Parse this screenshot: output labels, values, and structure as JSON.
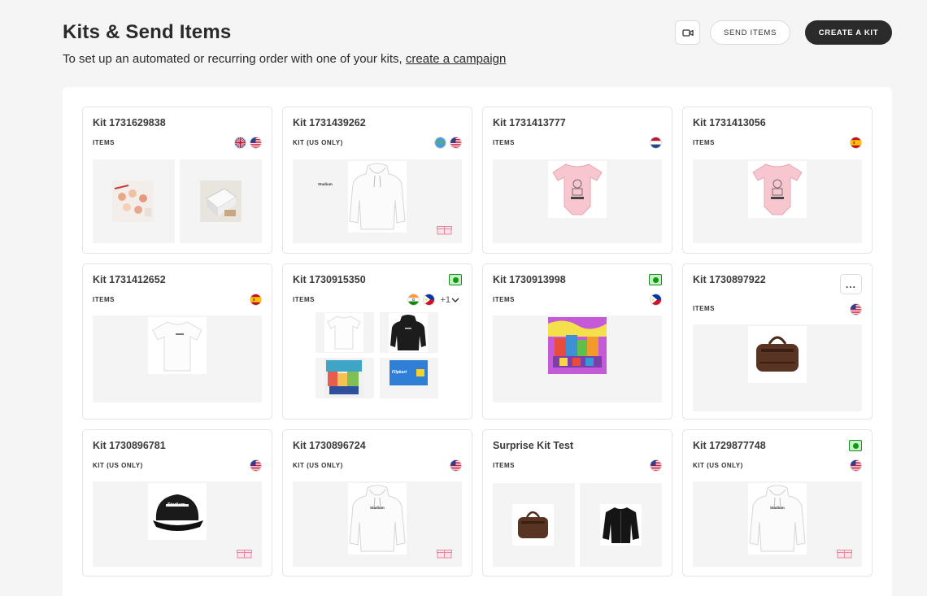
{
  "header": {
    "title": "Kits & Send Items",
    "subtitle_prefix": "To set up an automated or recurring order with one of your kits, ",
    "subtitle_link": "create a campaign",
    "send_items_label": "SEND ITEMS",
    "create_kit_label": "CREATE A KIT"
  },
  "kits": [
    {
      "title": "Kit 1731629838",
      "sub": "ITEMS",
      "flags": [
        "uk",
        "us"
      ]
    },
    {
      "title": "Kit 1731439262",
      "sub": "KIT (US ONLY)",
      "flags": [
        "globe",
        "us"
      ]
    },
    {
      "title": "Kit 1731413777",
      "sub": "ITEMS",
      "flags": [
        "nl"
      ]
    },
    {
      "title": "Kit 1731413056",
      "sub": "ITEMS",
      "flags": [
        "es"
      ]
    },
    {
      "title": "Kit 1731412652",
      "sub": "ITEMS",
      "flags": [
        "es"
      ]
    },
    {
      "title": "Kit 1730915350",
      "sub": "ITEMS",
      "flags": [
        "in",
        "ph"
      ],
      "more_flags": "+1",
      "status": "active"
    },
    {
      "title": "Kit 1730913998",
      "sub": "ITEMS",
      "flags": [
        "ph"
      ],
      "status": "active"
    },
    {
      "title": "Kit 1730897922",
      "sub": "ITEMS",
      "flags": [
        "us"
      ],
      "menu": "..."
    },
    {
      "title": "Kit 1730896781",
      "sub": "KIT (US ONLY)",
      "flags": [
        "us"
      ]
    },
    {
      "title": "Kit 1730896724",
      "sub": "KIT (US ONLY)",
      "flags": [
        "us"
      ]
    },
    {
      "title": "Surprise Kit Test",
      "sub": "ITEMS",
      "flags": [
        "us"
      ]
    },
    {
      "title": "Kit 1729877748",
      "sub": "KIT (US ONLY)",
      "flags": [
        "us"
      ],
      "status": "active"
    }
  ],
  "product_labels": {
    "hoodie_brand": "Stadium",
    "cap_brand": "Stadium",
    "gift_card": "Flipkart"
  },
  "colors": {
    "primary_dark": "#2b2b2b",
    "status_green": "#0d9a0d",
    "background": "#f5f5f5"
  }
}
